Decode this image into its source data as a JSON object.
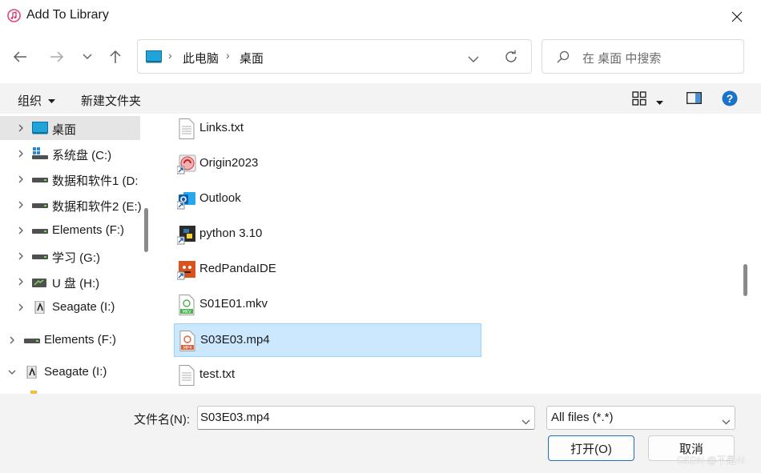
{
  "window": {
    "title": "Add To Library"
  },
  "address": {
    "crumbs": [
      "此电脑",
      "桌面"
    ]
  },
  "search": {
    "placeholder": "在 桌面 中搜索"
  },
  "toolbar": {
    "organize": "组织",
    "new_folder": "新建文件夹"
  },
  "sidebar": {
    "items": [
      {
        "label": "桌面",
        "icon": "desktop-icon"
      },
      {
        "label": "系统盘 (C:)",
        "icon": "windows-drive-icon"
      },
      {
        "label": "数据和软件1 (D:",
        "icon": "drive-icon"
      },
      {
        "label": "数据和软件2 (E:)",
        "icon": "drive-icon"
      },
      {
        "label": "Elements (F:)",
        "icon": "drive-icon"
      },
      {
        "label": "学习 (G:)",
        "icon": "drive-icon"
      },
      {
        "label": "U 盘 (H:)",
        "icon": "usb-drive-icon"
      },
      {
        "label": "Seagate (I:)",
        "icon": "seagate-drive-icon"
      },
      {
        "label": "Elements (F:)",
        "icon": "drive-icon"
      },
      {
        "label": "Seagate (I:)",
        "icon": "seagate-drive-icon"
      }
    ]
  },
  "files": [
    {
      "name": "Links.txt",
      "icon": "text-file-icon"
    },
    {
      "name": "Origin2023",
      "icon": "origin-shortcut-icon"
    },
    {
      "name": "Outlook",
      "icon": "outlook-shortcut-icon"
    },
    {
      "name": "python 3.10",
      "icon": "python-shortcut-icon"
    },
    {
      "name": "RedPandaIDE",
      "icon": "redpanda-shortcut-icon"
    },
    {
      "name": "S01E01.mkv",
      "icon": "mkv-file-icon"
    },
    {
      "name": "S03E03.mp4",
      "icon": "mp4-file-icon",
      "selected": true
    },
    {
      "name": "test.txt",
      "icon": "text-file-icon"
    }
  ],
  "footer": {
    "filename_label": "文件名(N):",
    "filename_value": "S03E03.mp4",
    "filetype_value": "All files (*.*)",
    "open_label": "打开(O)",
    "cancel_label": "取消",
    "watermark": "CSDN @不是AI"
  },
  "colors": {
    "selection": "#cce8ff",
    "accent": "#1f6fc2",
    "help": "#1a73c8"
  }
}
